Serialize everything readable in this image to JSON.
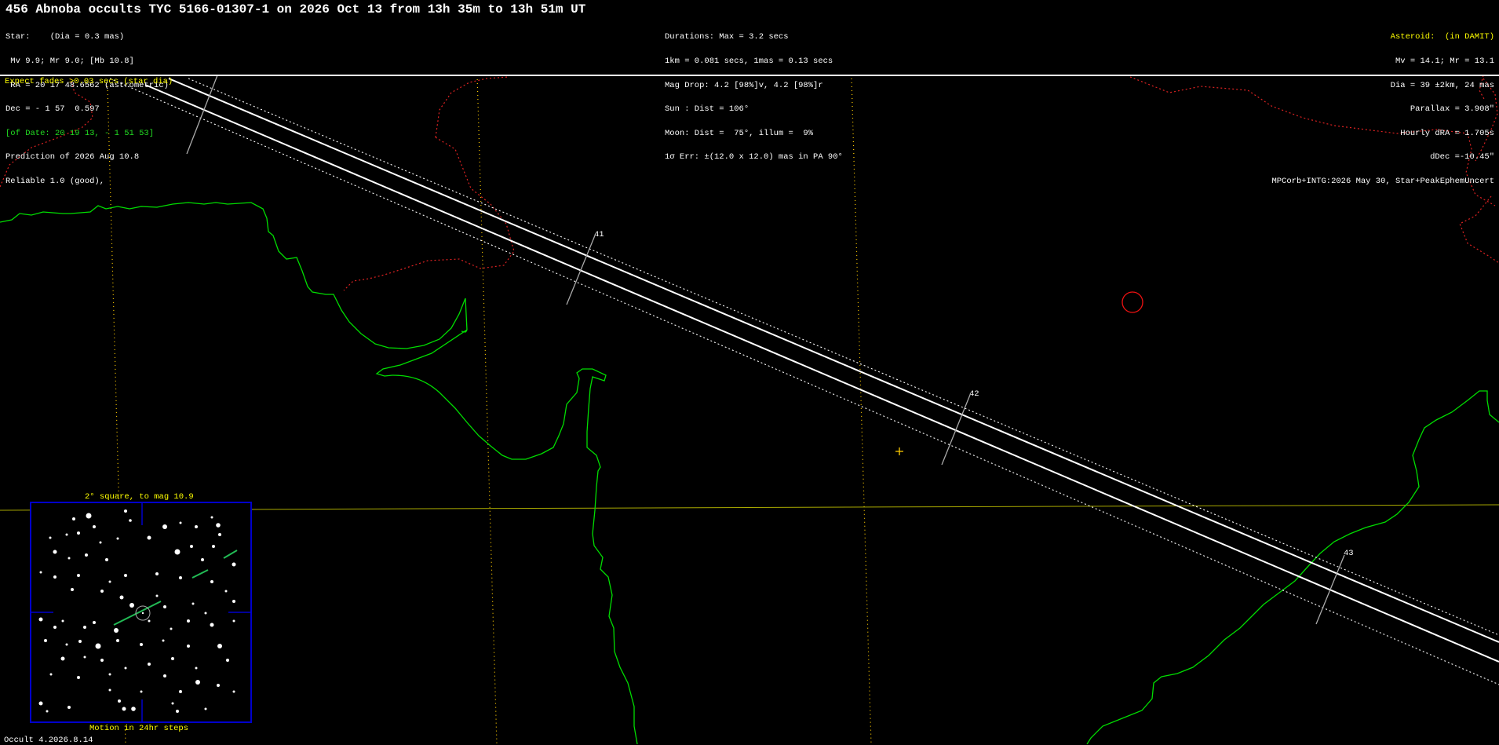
{
  "header": {
    "title": "456 Abnoba occults TYC 5166-01307-1 on 2026 Oct 13 from 13h 35m to 13h 51m UT",
    "left": [
      "Star:    (Dia = 0.3 mas)",
      " Mv 9.9; Mr 9.0; [Mb 10.8]",
      " RA = 20 17 48.6562 (astrometric)",
      "Dec = - 1 57  0.597",
      "[of Date: 20 19 13, - 1 51 53]",
      "Prediction of 2026 Aug 10.8",
      "Reliable 1.0 (good),"
    ],
    "middle": [
      "Durations: Max = 3.2 secs",
      "1km = 0.081 secs, 1mas = 0.13 secs",
      "Mag Drop: 4.2 [98%]v, 4.2 [98%]r",
      "Sun : Dist = 106°",
      "Moon: Dist =  75°, illum =  9%",
      "1σ Err: ±(12.0 x 12.0) mas in PA 90°"
    ],
    "right_title": "Asteroid:  (in DAMIT)",
    "right": [
      "Mv = 14.1; Mr = 13.1",
      "Dia = 39 ±2km, 24 mas",
      "Parallax = 3.908\"",
      "Hourly dRA = 1.705s",
      "dDec =-10.45\"",
      "MPCorb+INTG:2026 May 30, Star+PeakEphemUncert"
    ]
  },
  "map": {
    "fade_note": "Expect fades >0.03 secs (star dia)",
    "time_ticks": [
      "41",
      "42",
      "43"
    ]
  },
  "finder": {
    "caption_top": "2° square, to mag 10.9",
    "caption_bottom": "Motion in 24hr steps"
  },
  "footer": {
    "version": "Occult 4.2026.8.14"
  },
  "colors": {
    "background": "#000000",
    "path": "#ffffff",
    "coast": "#00dd00",
    "border": "#dd2222",
    "text_highlight": "#ffff00",
    "finder_frame": "#0000cc"
  }
}
